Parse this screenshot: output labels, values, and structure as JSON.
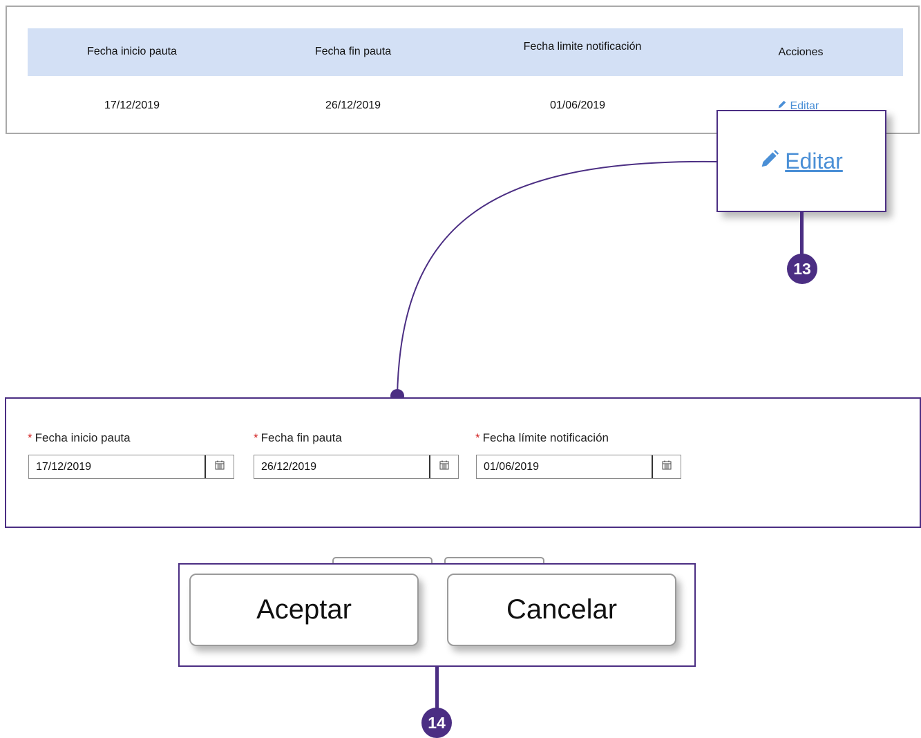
{
  "table": {
    "headers": [
      "Fecha inicio pauta",
      "Fecha fin pauta",
      "Fecha limite notificación",
      "Acciones"
    ],
    "row": [
      "17/12/2019",
      "26/12/2019",
      "01/06/2019"
    ],
    "edit_label": "Editar"
  },
  "callouts": {
    "edit": {
      "label": "Editar",
      "badge": "13"
    },
    "buttons": {
      "badge": "14"
    }
  },
  "form": {
    "fields": [
      {
        "required_mark": "*",
        "label": "Fecha inicio pauta",
        "value": "17/12/2019"
      },
      {
        "required_mark": "*",
        "label": "Fecha fin pauta",
        "value": "26/12/2019"
      },
      {
        "required_mark": "*",
        "label": "Fecha límite notificación",
        "value": "01/06/2019"
      }
    ]
  },
  "actions": {
    "accept_label": "Aceptar",
    "cancel_label": "Cancelar"
  },
  "colors": {
    "accent": "#4b2e83",
    "header_bg": "#d3e0f5",
    "link": "#4a8fd6",
    "required": "#d12020"
  },
  "icons": {
    "edit": "pencil-icon",
    "calendar": "calendar-icon"
  }
}
